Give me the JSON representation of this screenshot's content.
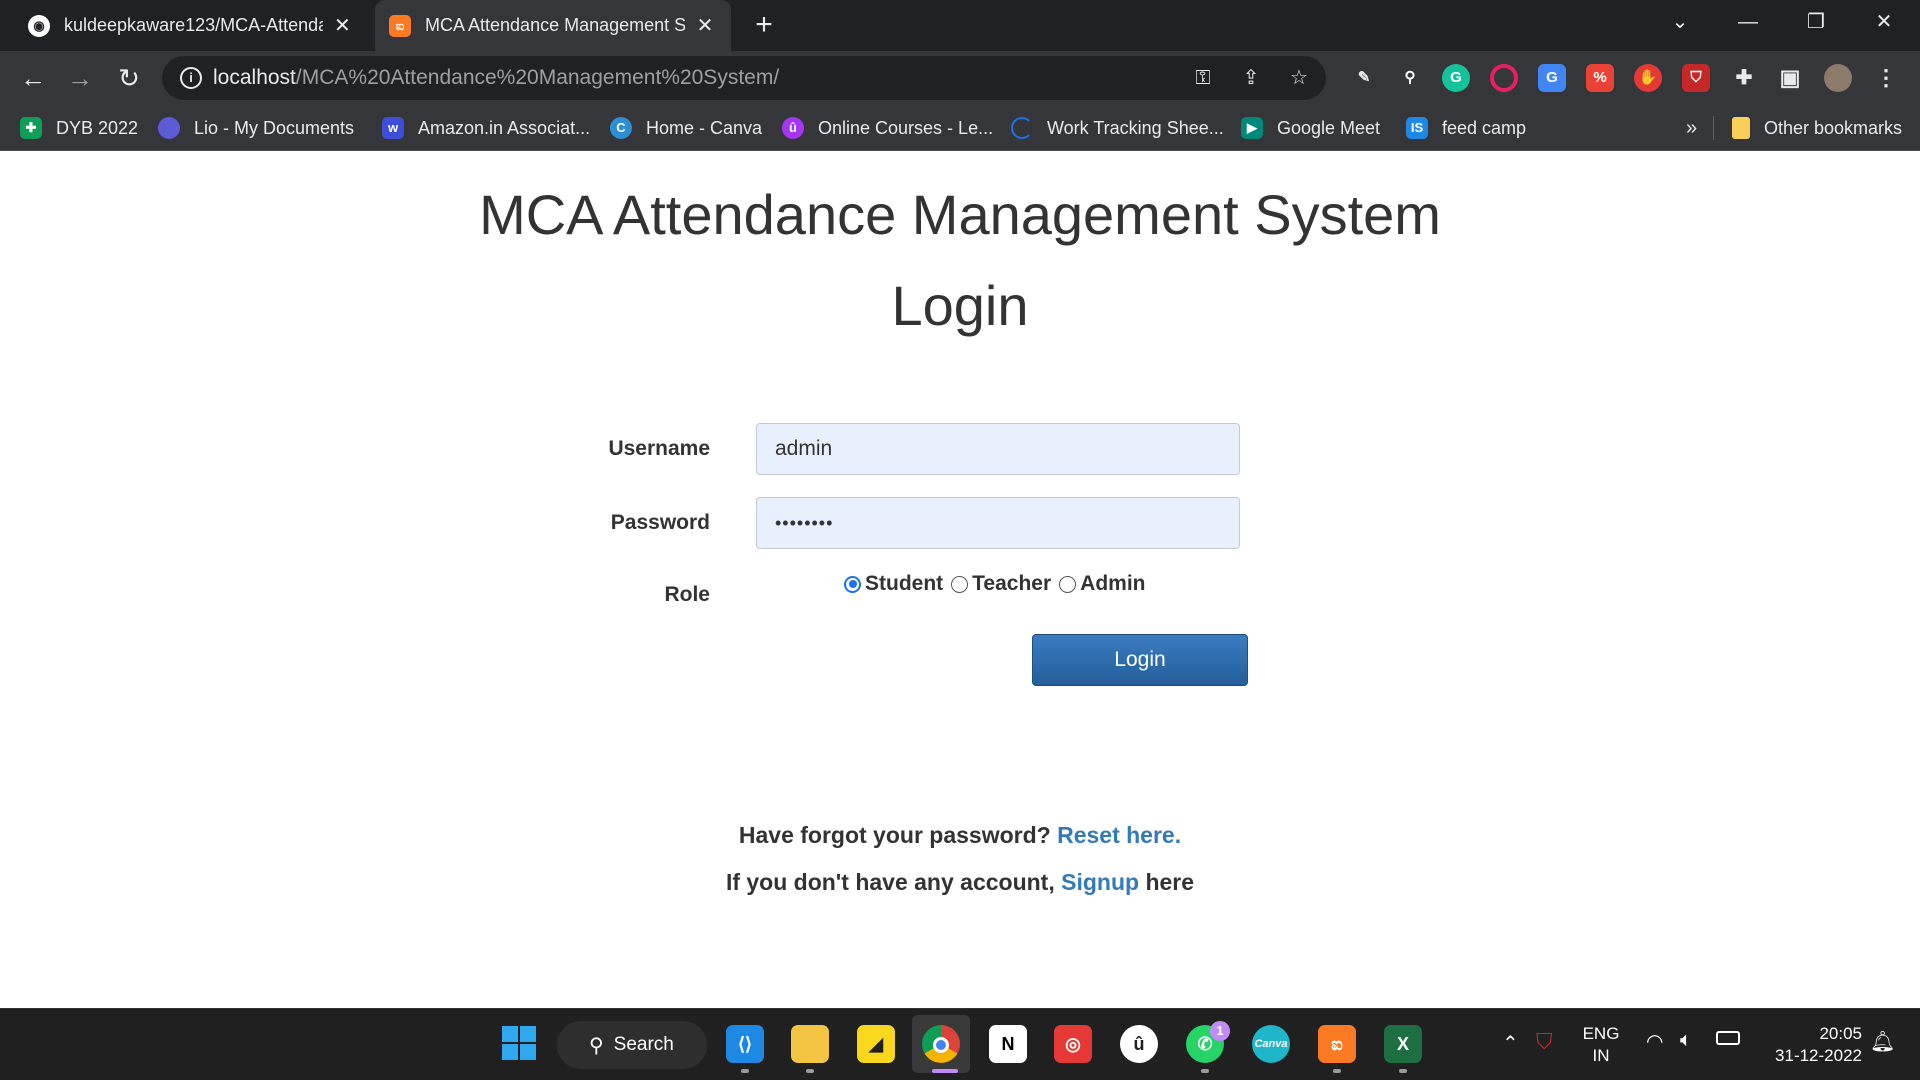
{
  "browser": {
    "tabs": [
      {
        "title": "kuldeepkaware123/MCA-Attendance",
        "icon": "github-icon",
        "active": false
      },
      {
        "title": "MCA Attendance Management System",
        "icon": "xampp-icon",
        "active": true
      }
    ],
    "url_host": "localhost",
    "url_path": "/MCA%20Attendance%20Management%20System/",
    "bookmarks": [
      {
        "label": "DYB 2022",
        "icon": "sheets-icon",
        "color": "#0f9d58"
      },
      {
        "label": "Lio - My Documents",
        "icon": "lio-icon",
        "color": "#5b5bd6"
      },
      {
        "label": "Amazon.in Associat...",
        "icon": "w-icon",
        "color": "#3b4fd8"
      },
      {
        "label": "Home - Canva",
        "icon": "canva-icon",
        "color": "#2c8fd6"
      },
      {
        "label": "Online Courses - Le...",
        "icon": "udemy-icon",
        "color": "#a435f0"
      },
      {
        "label": "Work Tracking Shee...",
        "icon": "loading-icon",
        "color": "#1a73e8"
      },
      {
        "label": "Google Meet",
        "icon": "meet-icon",
        "color": "#00897b"
      },
      {
        "label": "feed camp",
        "icon": "is-icon",
        "color": "#1e88e5"
      }
    ],
    "overflow_label": "»",
    "other_bookmarks": "Other bookmarks"
  },
  "page": {
    "title": "MCA Attendance Management System",
    "heading": "Login",
    "username_label": "Username",
    "username_value": "admin",
    "password_label": "Password",
    "password_mask": "••••••••",
    "role_label": "Role",
    "roles": [
      "Student",
      "Teacher",
      "Admin"
    ],
    "selected_role": "Student",
    "login_button": "Login",
    "forgot_text": "Have forgot your password?",
    "reset_link": "Reset here.",
    "signup_prefix": "If you don't have any account,",
    "signup_link": "Signup",
    "signup_suffix": "here"
  },
  "taskbar": {
    "search_label": "Search",
    "whatsapp_badge": "1",
    "language": "ENG",
    "region": "IN",
    "time": "20:05",
    "date": "31-12-2022"
  }
}
